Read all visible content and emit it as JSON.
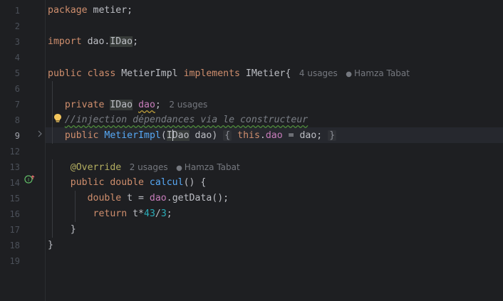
{
  "line_numbers": [
    "1",
    "2",
    "3",
    "4",
    "5",
    "6",
    "7",
    "8",
    "9",
    "12",
    "13",
    "14",
    "15",
    "16",
    "17",
    "18",
    "19"
  ],
  "code": {
    "l1": {
      "kw": "package",
      "rest": " metier;"
    },
    "l3": {
      "kw": "import",
      "pkg": " dao.",
      "cls": "IDao",
      "end": ";"
    },
    "l5": {
      "kw1": "public",
      "kw2": " class",
      "name": " MetierImpl",
      "kw3": " implements",
      "iface": " IMetier{",
      "usages": "4 usages",
      "author": "Hamza Tabat"
    },
    "l7": {
      "kw": "private",
      "type": "IDao",
      "field": "dao",
      "end": ";",
      "usages": "2 usages"
    },
    "l8": {
      "comment": "//injection dépendances via le constructeur"
    },
    "l9": {
      "kw": "public",
      "ctor": "MetierImpl",
      "paren_open": "(",
      "type_a": "I",
      "type_b": "Dao",
      "param": " dao)",
      "brace_open": "{",
      "this": "this",
      "dot": ".",
      "field": "dao",
      "assign": " = dao;",
      "brace_close": "}"
    },
    "l13": {
      "ann": "@Override",
      "usages": "2 usages",
      "author": "Hamza Tabat"
    },
    "l14": {
      "kw1": "public",
      "kw2": " double",
      "fn": " calcul",
      "rest": "() {"
    },
    "l15": {
      "kw": "double",
      "var": " t = ",
      "field": "dao",
      "call": ".getData();"
    },
    "l16": {
      "kw": "return",
      "expr": " t*",
      "n1": "43",
      "op": "/",
      "n2": "3",
      "end": ";"
    },
    "l17": {
      "text": "}"
    },
    "l18": {
      "text": "}"
    }
  },
  "icons": {
    "bulb": "lightbulb-icon",
    "fold": "chevron-right-icon",
    "impl": "implements-gutter-icon",
    "person": "person-icon"
  },
  "colors": {
    "background": "#1e1f22",
    "keyword": "#cf8e6d",
    "function": "#56a8f5",
    "field": "#c77dbb",
    "annotation": "#b3ae60",
    "number": "#2aacb8",
    "comment": "#7a7e85",
    "text": "#bcbec4"
  }
}
